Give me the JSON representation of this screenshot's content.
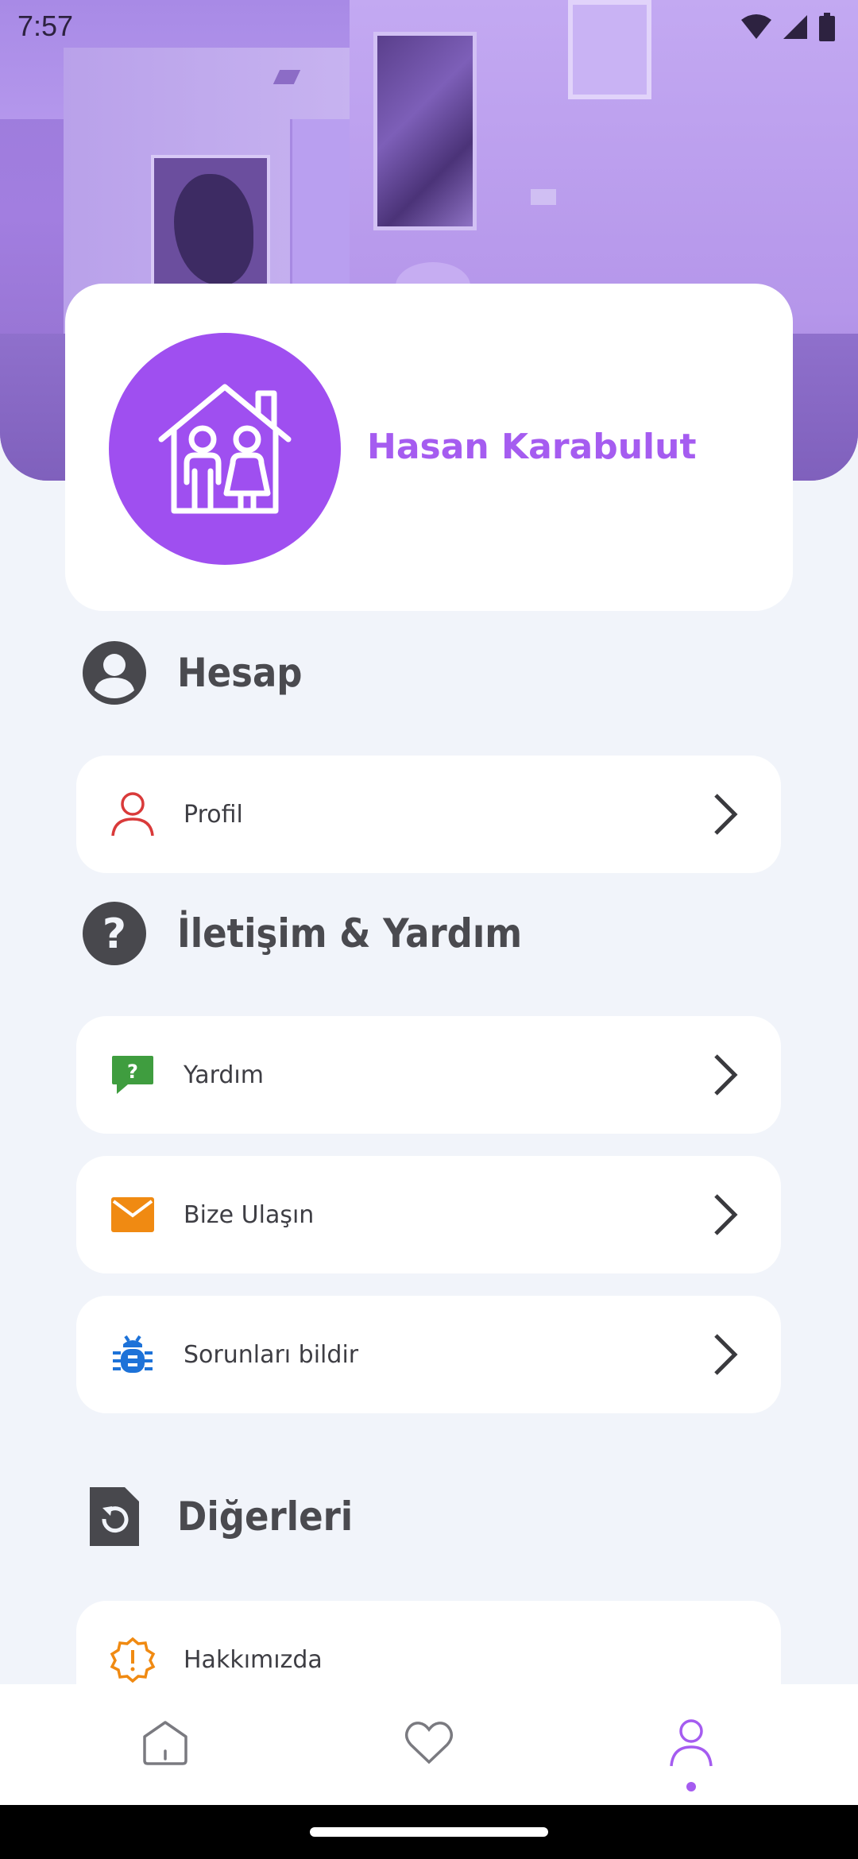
{
  "status_bar": {
    "time": "7:57"
  },
  "profile": {
    "name": "Hasan Karabulut",
    "avatar_icon": "family-house-icon",
    "accent": "#9f4ff0"
  },
  "sections": {
    "account": {
      "title": "Hesap",
      "icon": "account-circle-icon"
    },
    "contact": {
      "title": "İletişim & Yardım",
      "icon": "help-circle-icon"
    },
    "others": {
      "title": "Diğerleri",
      "icon": "restore-file-icon"
    }
  },
  "menu": {
    "profile": {
      "label": "Profil",
      "icon": "person-outline-icon",
      "color": "#d93a3a"
    },
    "help": {
      "label": "Yardım",
      "icon": "chat-question-icon",
      "color": "#3f9d3f"
    },
    "contact_us": {
      "label": "Bize Ulaşın",
      "icon": "mail-icon",
      "color": "#f08a12"
    },
    "report": {
      "label": "Sorunları bildir",
      "icon": "bug-icon",
      "color": "#1d72d8"
    },
    "about": {
      "label": "Hakkımızda",
      "icon": "alert-badge-icon",
      "color": "#f08a12"
    }
  },
  "bottom_nav": {
    "items": [
      {
        "name": "home",
        "icon": "home-icon"
      },
      {
        "name": "favorites",
        "icon": "heart-icon"
      },
      {
        "name": "profile",
        "icon": "person-icon",
        "active": true
      }
    ]
  }
}
